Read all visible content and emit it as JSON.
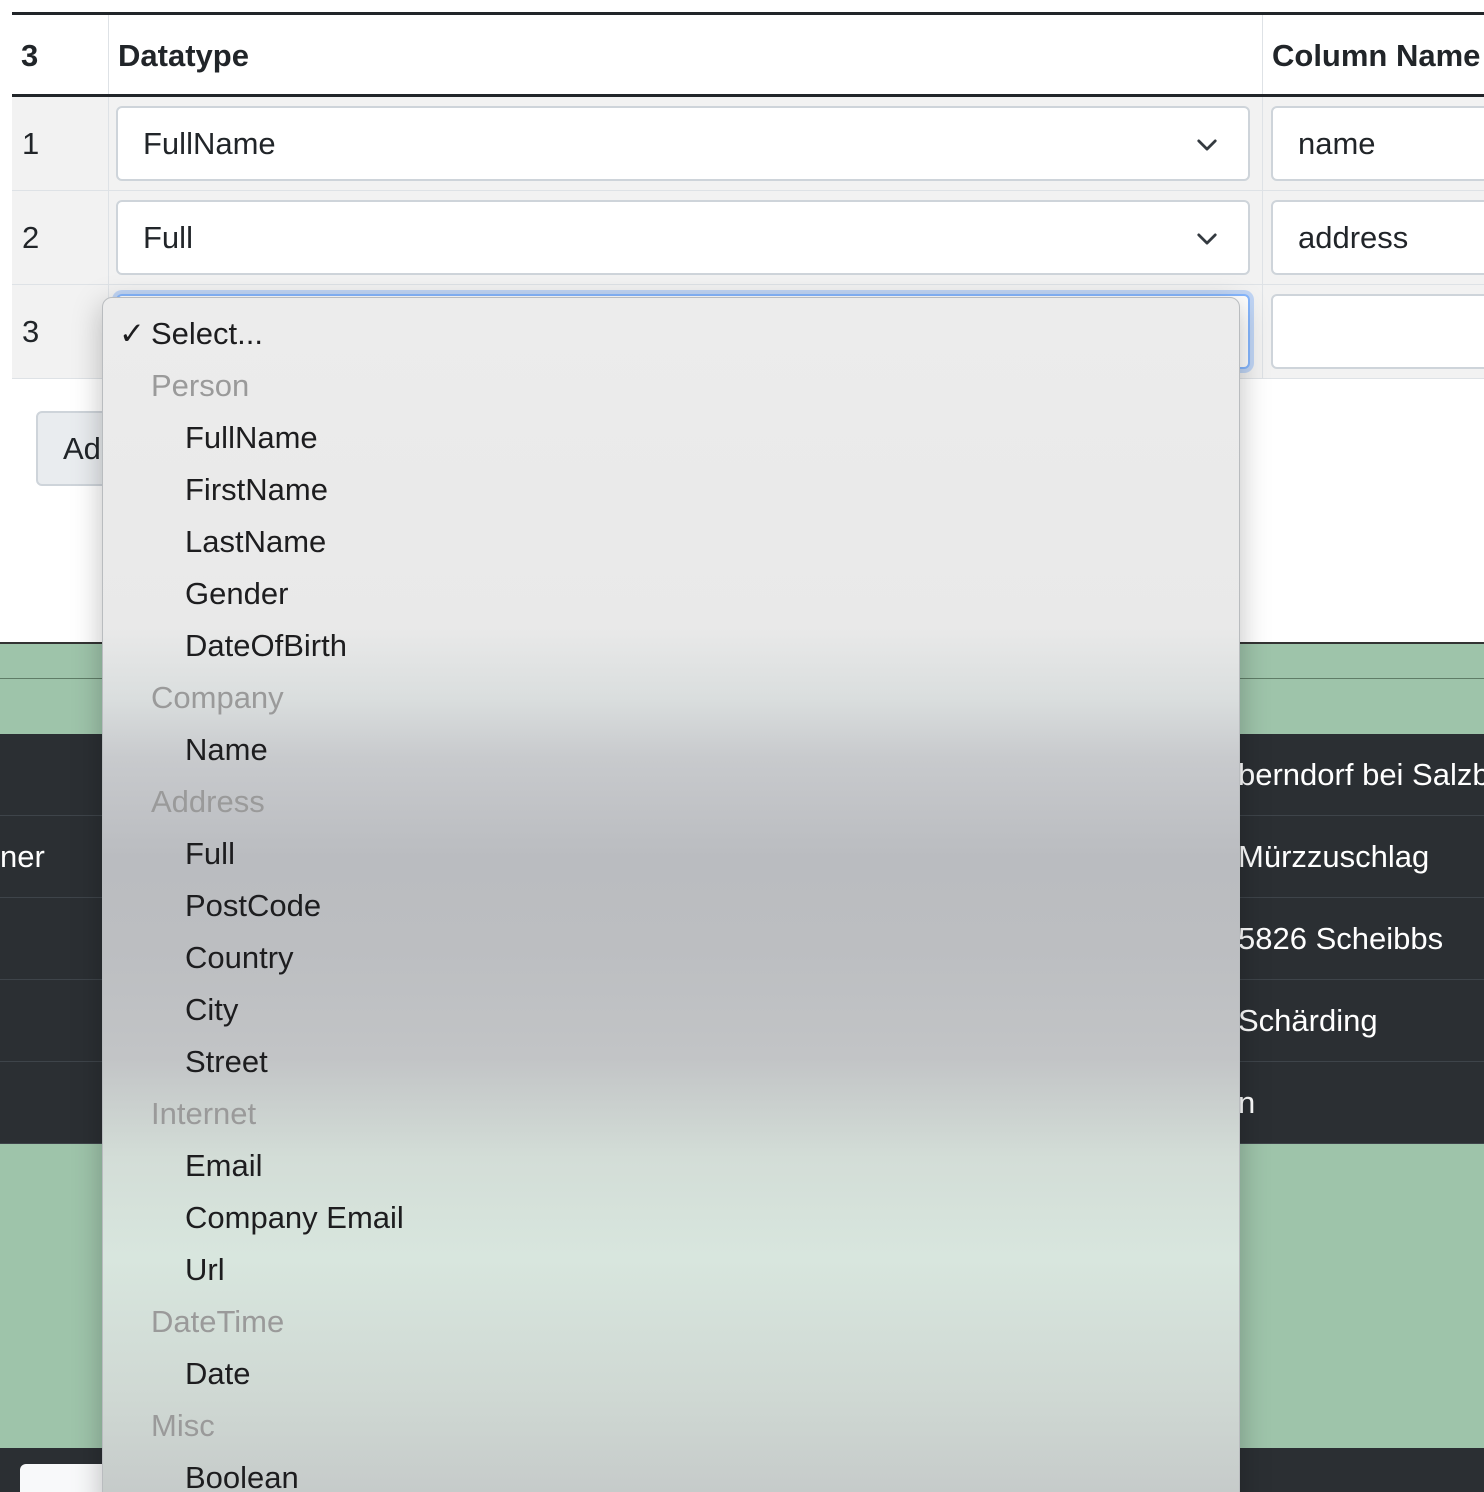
{
  "schema_table": {
    "header": {
      "count": "3",
      "datatype": "Datatype",
      "column_name": "Column Name"
    },
    "rows": [
      {
        "index": "1",
        "datatype": "FullName",
        "column_name": "name"
      },
      {
        "index": "2",
        "datatype": "Full",
        "column_name": "address"
      },
      {
        "index": "3",
        "datatype": "",
        "column_name": ""
      }
    ]
  },
  "add_button": {
    "label": "Ad"
  },
  "preview_rows": [
    {
      "left": "",
      "right": "berndorf bei Salzb"
    },
    {
      "left": "ner",
      "right": "Mürzzuschlag"
    },
    {
      "left": "",
      "right": "5826 Scheibbs"
    },
    {
      "left": "",
      "right": "Schärding"
    },
    {
      "left": "",
      "right": "n"
    }
  ],
  "dropdown": {
    "selected_check": "✓",
    "selected_label": "Select...",
    "groups": [
      {
        "label": "Person",
        "options": [
          "FullName",
          "FirstName",
          "LastName",
          "Gender",
          "DateOfBirth"
        ]
      },
      {
        "label": "Company",
        "options": [
          "Name"
        ]
      },
      {
        "label": "Address",
        "options": [
          "Full",
          "PostCode",
          "Country",
          "City",
          "Street"
        ]
      },
      {
        "label": "Internet",
        "options": [
          "Email",
          "Company Email",
          "Url"
        ]
      },
      {
        "label": "DateTime",
        "options": [
          "Date"
        ]
      },
      {
        "label": "Misc",
        "options": [
          "Boolean"
        ]
      }
    ]
  },
  "colors": {
    "focus_ring": "#86b7fe",
    "preview_background": "#9ec4aa",
    "dark_row": "#2b2f33"
  }
}
